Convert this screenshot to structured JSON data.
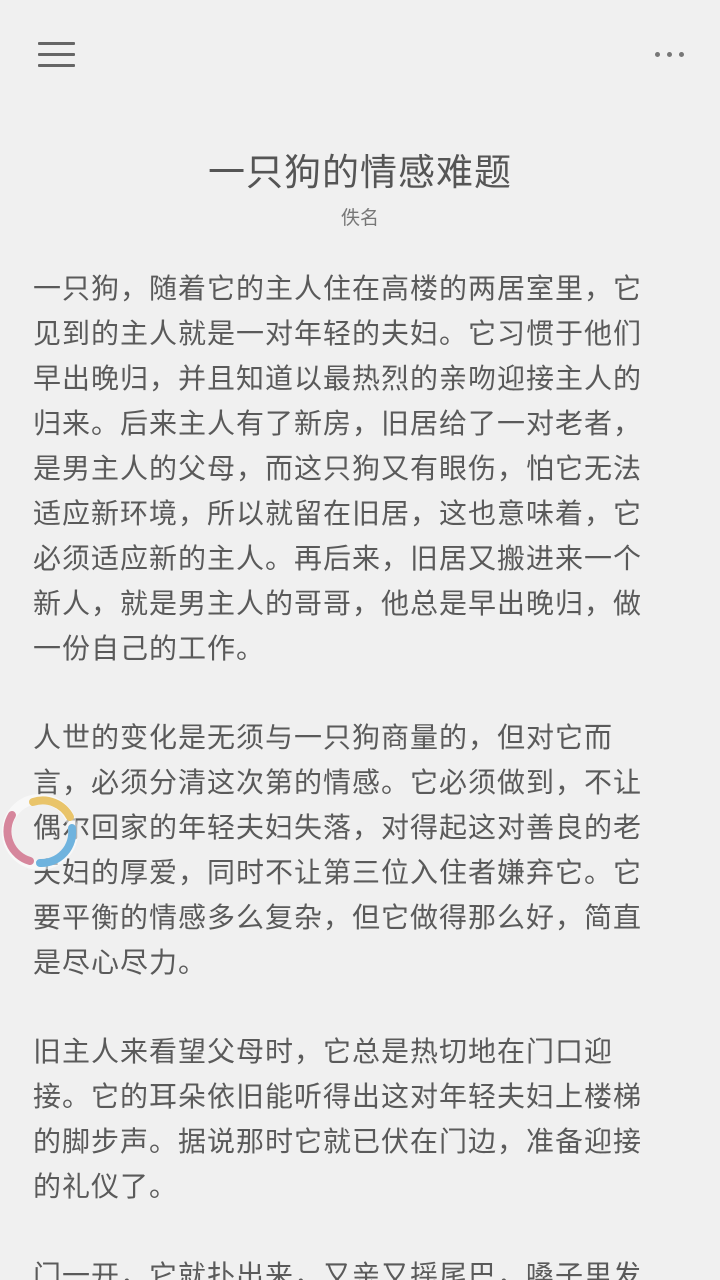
{
  "toolbar": {
    "menu_icon": "hamburger-menu-icon",
    "more_icon": "more-horizontal-icon"
  },
  "article": {
    "title": "一只狗的情感难题",
    "author": "佚名",
    "paragraphs": [
      "一只狗，随着它的主人住在高楼的两居室里，它见到的主人就是一对年轻的夫妇。它习惯于他们早出晚归，并且知道以最热烈的亲吻迎接主人的归来。后来主人有了新房，旧居给了一对老者，是男主人的父母，而这只狗又有眼伤，怕它无法适应新环境，所以就留在旧居，这也意味着，它必须适应新的主人。再后来，旧居又搬进来一个新人，就是男主人的哥哥，他总是早出晚归，做一份自己的工作。",
      "人世的变化是无须与一只狗商量的，但对它而言，必须分清这次第的情感。它必须做到，不让偶尔回家的年轻夫妇失落，对得起这对善良的老夫妇的厚爱，同时不让第三位入住者嫌弃它。它要平衡的情感多么复杂，但它做得那么好，简直是尽心尽力。",
      "旧主人来看望父母时，它总是热切地在门口迎接。它的耳朵依旧能听得出这对年轻夫妇上楼梯的脚步声。据说那时它就已伏在门边，准备迎接的礼仪了。",
      "门一开，它就扑出来，又亲又摇尾巴，嗓子里发"
    ]
  },
  "loader": {
    "icon": "loading-spinner-icon",
    "colors": [
      "#e9c46a",
      "#6fb3de",
      "#d6869c",
      "#9cc98b"
    ]
  }
}
